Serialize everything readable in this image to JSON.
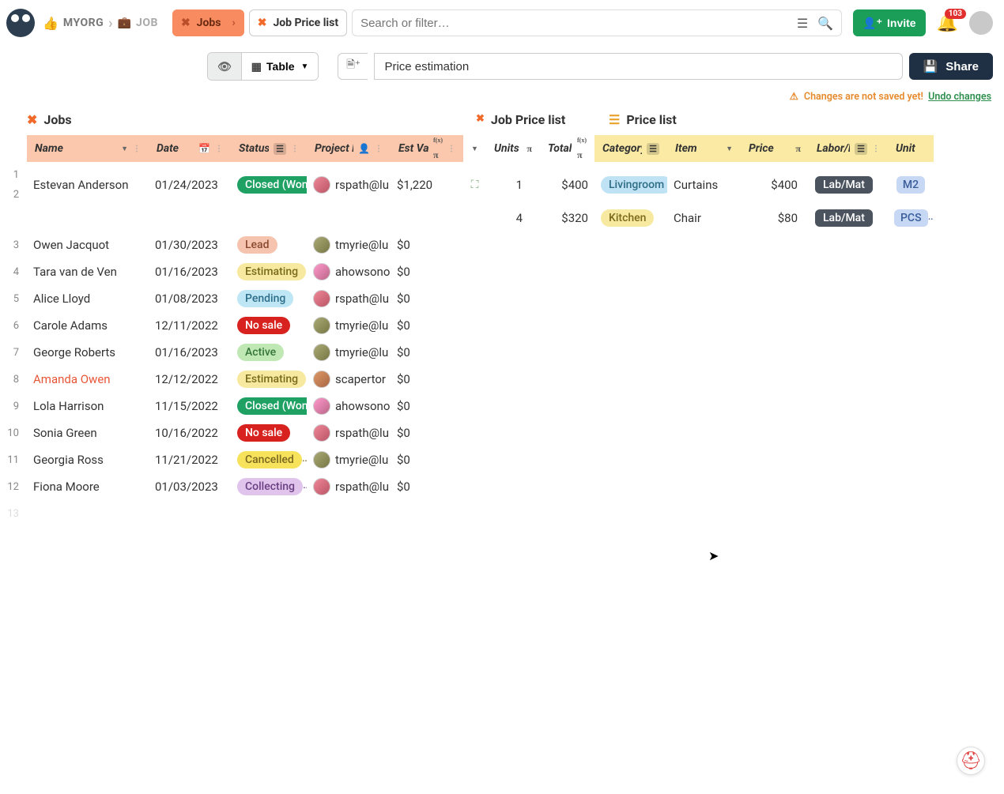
{
  "topbar": {
    "org": "MYORG",
    "job": "JOB",
    "tabs": {
      "jobs": "Jobs",
      "priceList": "Job Price list"
    },
    "search_placeholder": "Search or filter…",
    "invite": "Invite",
    "notification_count": "103"
  },
  "secondbar": {
    "view_label": "Table",
    "title_value": "Price estimation",
    "share": "Share"
  },
  "unsaved": {
    "warn": "Changes are not saved yet!",
    "undo": "Undo changes"
  },
  "sections": {
    "jobs": "Jobs",
    "jobPriceList": "Job Price list",
    "priceList": "Price list"
  },
  "columns": {
    "name": "Name",
    "date": "Date",
    "status": "Status",
    "pm": "Project M…",
    "est": "Est Value",
    "units": "Units",
    "total": "Total",
    "category": "Category",
    "item": "Item",
    "price": "Price",
    "labor": "Labor/Ma…",
    "unit": "Unit"
  },
  "jobs": [
    {
      "n": "1",
      "n2": "2",
      "name": "Estevan Anderson",
      "date": "01/24/2023",
      "status": "Closed (Won)",
      "statusClass": "green",
      "pm": "rspath@lu",
      "av": "av-a",
      "est": "$1,220"
    },
    {
      "n": "3",
      "name": "Owen Jacquot",
      "date": "01/30/2023",
      "status": "Lead",
      "statusClass": "lead",
      "pm": "tmyrie@lu",
      "av": "av-b",
      "est": "$0"
    },
    {
      "n": "4",
      "name": "Tara van de Ven",
      "date": "01/16/2023",
      "status": "Estimating",
      "statusClass": "est",
      "pm": "ahowsono",
      "av": "av-c",
      "est": "$0"
    },
    {
      "n": "5",
      "name": "Alice Lloyd",
      "date": "01/08/2023",
      "status": "Pending",
      "statusClass": "pend",
      "pm": "rspath@lu",
      "av": "av-a",
      "est": "$0"
    },
    {
      "n": "6",
      "name": "Carole Adams",
      "date": "12/11/2022",
      "status": "No sale",
      "statusClass": "nosale",
      "pm": "tmyrie@lu",
      "av": "av-b",
      "est": "$0"
    },
    {
      "n": "7",
      "name": "George Roberts",
      "date": "01/16/2023",
      "status": "Active",
      "statusClass": "active",
      "pm": "tmyrie@lu",
      "av": "av-b",
      "est": "$0"
    },
    {
      "n": "8",
      "name": "Amanda Owen",
      "date": "12/12/2022",
      "status": "Estimating",
      "statusClass": "est",
      "pm": "scapertor",
      "av": "av-d",
      "est": "$0",
      "nameClass": "name-red"
    },
    {
      "n": "9",
      "name": "Lola Harrison",
      "date": "11/15/2022",
      "status": "Closed (Won)",
      "statusClass": "green",
      "pm": "ahowsono",
      "av": "av-c",
      "est": "$0"
    },
    {
      "n": "10",
      "name": "Sonia Green",
      "date": "10/16/2022",
      "status": "No sale",
      "statusClass": "nosale",
      "pm": "rspath@lu",
      "av": "av-a",
      "est": "$0"
    },
    {
      "n": "11",
      "name": "Georgia Ross",
      "date": "11/21/2022",
      "status": "Cancelled",
      "statusClass": "cancel",
      "pm": "tmyrie@lu",
      "av": "av-b",
      "est": "$0"
    },
    {
      "n": "12",
      "name": "Fiona Moore",
      "date": "01/03/2023",
      "status": "Collecting",
      "statusClass": "collect",
      "pm": "rspath@lu",
      "av": "av-a",
      "est": "$0"
    }
  ],
  "priceRows": [
    {
      "units": "1",
      "total": "$400",
      "cat": "Livingroom",
      "catClass": "room1",
      "item": "Curtains",
      "price": "$400",
      "labor": "Lab/Mat",
      "unit": "M2"
    },
    {
      "units": "4",
      "total": "$320",
      "cat": "Kitchen",
      "catClass": "room2",
      "item": "Chair",
      "price": "$80",
      "labor": "Lab/Mat",
      "unit": "PCS"
    }
  ]
}
